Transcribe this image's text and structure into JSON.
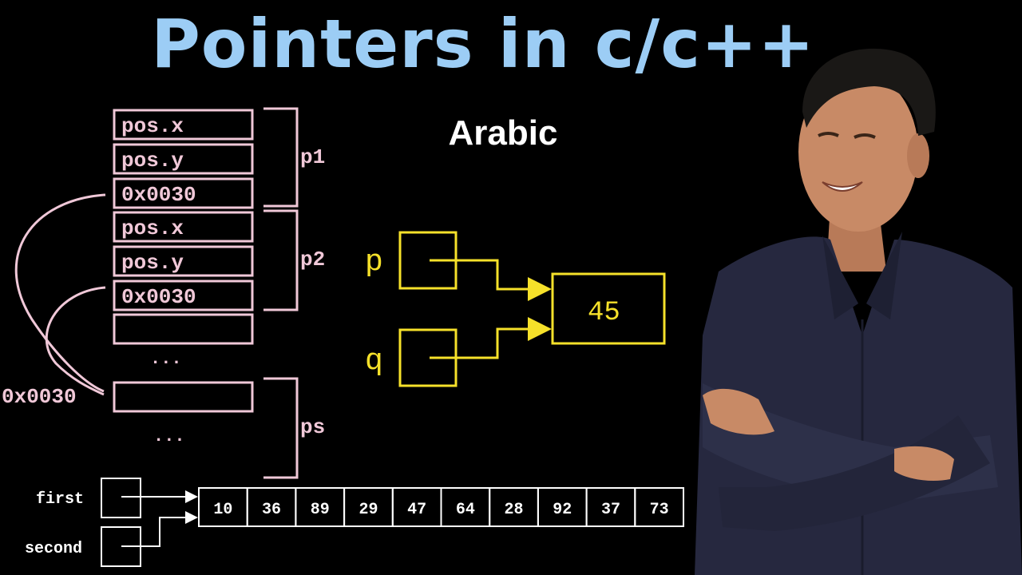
{
  "title": "Pointers in c/c++",
  "subtitle": "Arabic",
  "memory_diagram": {
    "cells": [
      "pos.x",
      "pos.y",
      "0x0030",
      "pos.x",
      "pos.y",
      "0x0030",
      "",
      "",
      ""
    ],
    "ellipsis_1": "...",
    "ellipsis_2": "...",
    "address_label": "0x0030",
    "brackets": [
      "p1",
      "p2",
      "ps"
    ]
  },
  "pointer_diagram": {
    "pointer_labels": [
      "p",
      "q"
    ],
    "target_value": "45"
  },
  "array_diagram": {
    "pointer_labels": [
      "first",
      "second"
    ],
    "values": [
      "10",
      "36",
      "89",
      "29",
      "47",
      "64",
      "28",
      "92",
      "37",
      "73"
    ]
  },
  "colors": {
    "title": "#9ccdf5",
    "memory": "#f0c8d8",
    "pointer": "#f6e12a",
    "array": "#ffffff",
    "shirt": "#26283f",
    "skin": "#c88a66",
    "hair": "#1a1816"
  }
}
